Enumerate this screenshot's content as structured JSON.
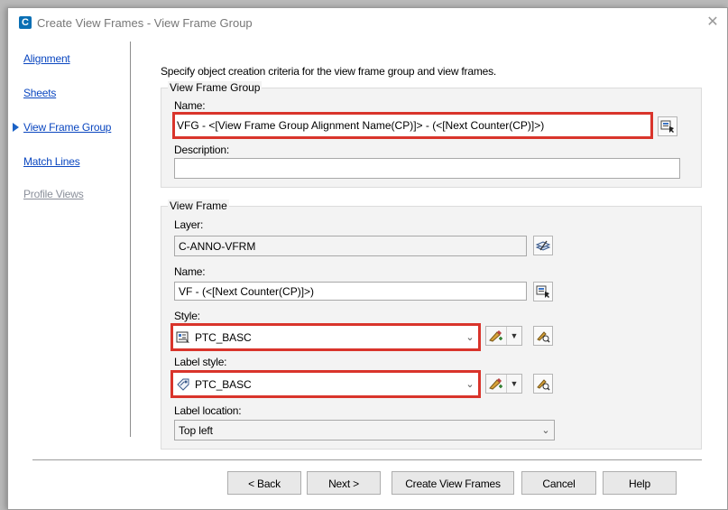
{
  "window": {
    "title": "Create View Frames - View Frame Group",
    "app_icon_letter": "C",
    "close_glyph": "✕"
  },
  "nav": {
    "items": [
      {
        "label": "Alignment"
      },
      {
        "label": "Sheets"
      },
      {
        "label": "View Frame Group"
      },
      {
        "label": "Match Lines"
      },
      {
        "label": "Profile Views"
      }
    ]
  },
  "intro": "Specify object creation criteria for the view frame group and view frames.",
  "vfg": {
    "title": "View Frame Group",
    "name_label": "Name:",
    "name_value": "VFG - <[View Frame Group Alignment Name(CP)]> - (<[Next Counter(CP)]>)",
    "description_label": "Description:",
    "description_value": ""
  },
  "vf": {
    "title": "View Frame",
    "layer_label": "Layer:",
    "layer_value": "C-ANNO-VFRM",
    "name_label": "Name:",
    "name_value": "VF - (<[Next Counter(CP)]>)",
    "style_label": "Style:",
    "style_value": "PTC_BASC",
    "label_style_label": "Label style:",
    "label_style_value": "PTC_BASC",
    "label_location_label": "Label location:",
    "label_location_value": "Top left"
  },
  "buttons": {
    "back": "< Back",
    "next": "Next >",
    "create": "Create View Frames",
    "cancel": "Cancel",
    "help": "Help"
  },
  "colors": {
    "highlight": "#d9342b",
    "link": "#0b47c0",
    "accent": "#0a6fb4"
  }
}
